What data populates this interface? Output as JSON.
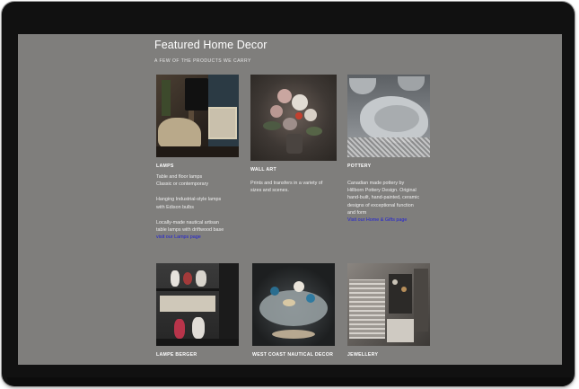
{
  "page": {
    "title": "Featured Home Decor",
    "subtitle": "A FEW OF THE PRODUCTS WE CARRY"
  },
  "products": [
    {
      "title": "LAMPS",
      "paragraphs": [
        [
          "Table and floor lamps",
          "Classic or contemporary"
        ],
        [
          "Hanging Industrial-style lamps",
          "with Edison bulbs"
        ],
        [
          "Locally-made nautical artisan",
          "table lamps with driftwood base"
        ]
      ],
      "link": "visit our Lamps page"
    },
    {
      "title": "WALL ART",
      "paragraphs": [
        [
          "Prints and transfers in a variety of",
          "sizes and scenes."
        ]
      ]
    },
    {
      "title": "POTTERY",
      "paragraphs": [
        [
          "Canadian made pottery by",
          "Hillborn Pottery Design. Original",
          "hand-built, hand-painted, ceramic",
          "designs of exceptional function",
          "and form"
        ]
      ],
      "link": "Visit our Home & Gifts page"
    },
    {
      "title": "LAMPE BERGER"
    },
    {
      "title": "WEST COAST NAUTICAL DECOR"
    },
    {
      "title": "JEWELLERY"
    }
  ]
}
